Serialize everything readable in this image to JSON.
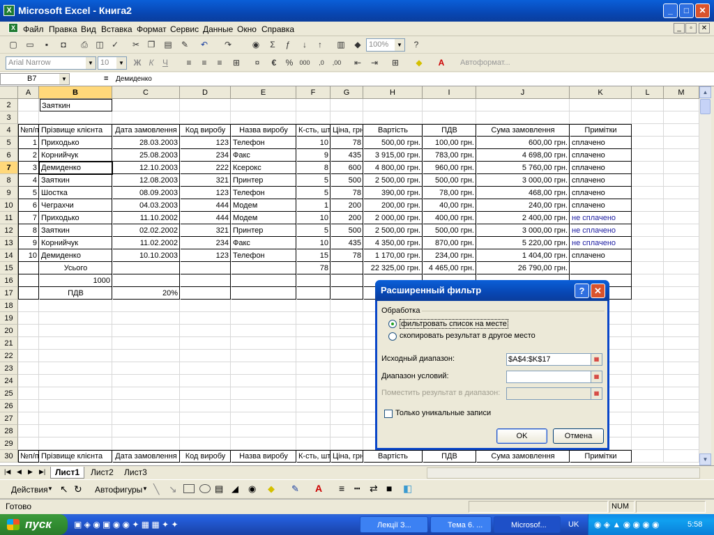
{
  "window": {
    "title": "Microsoft Excel - Книга2"
  },
  "menu": [
    "Файл",
    "Правка",
    "Вид",
    "Вставка",
    "Формат",
    "Сервис",
    "Данные",
    "Окно",
    "Справка"
  ],
  "toolbar": {
    "zoom": "100%",
    "font": "Arial Narrow",
    "size": "10",
    "autoformat": "Автоформат..."
  },
  "formula": {
    "cell_ref": "B7",
    "eq": "=",
    "value": "Демиденко"
  },
  "grid": {
    "columns": [
      "A",
      "B",
      "C",
      "D",
      "E",
      "F",
      "G",
      "H",
      "I",
      "J",
      "K",
      "L",
      "M"
    ],
    "rows": [
      "2",
      "3",
      "4",
      "5",
      "6",
      "7",
      "8",
      "9",
      "10",
      "11",
      "12",
      "13",
      "14",
      "15",
      "16",
      "17",
      "18",
      "19",
      "20",
      "21",
      "22",
      "23",
      "24",
      "25",
      "26",
      "27",
      "28",
      "29",
      "30"
    ],
    "header": [
      "№п/п",
      "Прізвище клієнта",
      "Дата замовлення",
      "Код виробу",
      "Назва виробу",
      "К-сть, шт",
      "Ціна, грн",
      "Вартість",
      "ПДВ",
      "Сума замовлення",
      "Примітки"
    ],
    "row2_b": "Заяткин",
    "data": [
      [
        "1",
        "Приходько",
        "28.03.2003",
        "123",
        "Телефон",
        "10",
        "78",
        "500,00 грн.",
        "100,00 грн.",
        "600,00 грн.",
        "сплачено"
      ],
      [
        "2",
        "Корнийчук",
        "25.08.2003",
        "234",
        "Факс",
        "9",
        "435",
        "3 915,00 грн.",
        "783,00 грн.",
        "4 698,00 грн.",
        "сплачено"
      ],
      [
        "3",
        "Демиденко",
        "12.10.2003",
        "222",
        "Ксерокс",
        "8",
        "600",
        "4 800,00 грн.",
        "960,00 грн.",
        "5 760,00 грн.",
        "сплачено"
      ],
      [
        "4",
        "Заяткин",
        "12.08.2003",
        "321",
        "Принтер",
        "5",
        "500",
        "2 500,00 грн.",
        "500,00 грн.",
        "3 000,00 грн.",
        "сплачено"
      ],
      [
        "5",
        "Шостка",
        "08.09.2003",
        "123",
        "Телефон",
        "5",
        "78",
        "390,00 грн.",
        "78,00 грн.",
        "468,00 грн.",
        "сплачено"
      ],
      [
        "6",
        "Чеграхчи",
        "04.03.2003",
        "444",
        "Модем",
        "1",
        "200",
        "200,00 грн.",
        "40,00 грн.",
        "240,00 грн.",
        "сплачено"
      ],
      [
        "7",
        "Приходько",
        "11.10.2002",
        "444",
        "Модем",
        "10",
        "200",
        "2 000,00 грн.",
        "400,00 грн.",
        "2 400,00 грн.",
        "не сплачено"
      ],
      [
        "8",
        "Заяткин",
        "02.02.2002",
        "321",
        "Принтер",
        "5",
        "500",
        "2 500,00 грн.",
        "500,00 грн.",
        "3 000,00 грн.",
        "не сплачено"
      ],
      [
        "9",
        "Корнийчук",
        "11.02.2002",
        "234",
        "Факс",
        "10",
        "435",
        "4 350,00 грн.",
        "870,00 грн.",
        "5 220,00 грн.",
        "не сплачено"
      ],
      [
        "10",
        "Демиденко",
        "10.10.2003",
        "123",
        "Телефон",
        "15",
        "78",
        "1 170,00 грн.",
        "234,00 грн.",
        "1 404,00 грн.",
        "сплачено"
      ]
    ],
    "total": {
      "label": "Усього",
      "qty": "78",
      "cost": "22 325,00 грн.",
      "vat": "4 465,00 грн.",
      "sum": "26 790,00 грн."
    },
    "row16_b": "1000",
    "row17": {
      "label": "ПДВ",
      "value": "20%"
    }
  },
  "sheets": [
    "Лист1",
    "Лист2",
    "Лист3"
  ],
  "drawbar": {
    "actions": "Действия",
    "autoshapes": "Автофигуры"
  },
  "status": {
    "ready": "Готово",
    "num": "NUM"
  },
  "taskbar": {
    "start": "пуск",
    "tasks": [
      "Лекції З...",
      "Тема 6. ...",
      "Microsof..."
    ],
    "lang": "UK",
    "clock": "5:58"
  },
  "dialog": {
    "title": "Расширенный фильтр",
    "group": "Обработка",
    "opt1": "фильтровать список на месте",
    "opt2": "скопировать результат в другое место",
    "src_label": "Исходный диапазон:",
    "src_value": "$A$4:$K$17",
    "cond_label": "Диапазон условий:",
    "dest_label": "Поместить результат в диапазон:",
    "unique": "Только уникальные записи",
    "ok": "OK",
    "cancel": "Отмена"
  }
}
